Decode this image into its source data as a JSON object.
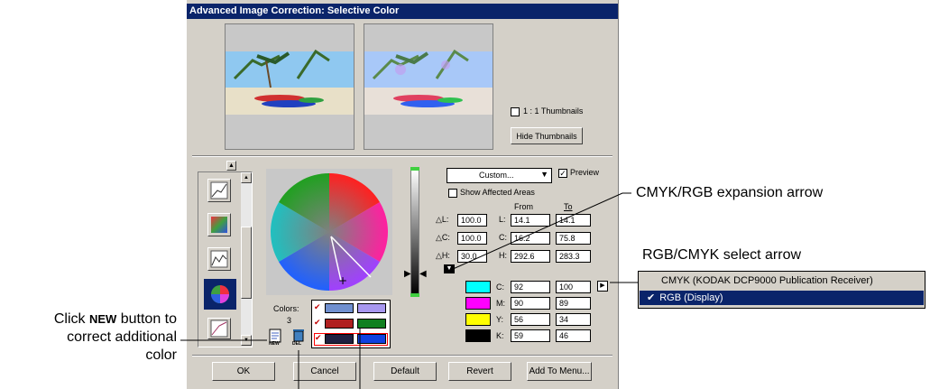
{
  "window": {
    "title": "Advanced Image Correction: Selective Color"
  },
  "thumbnails": {
    "one_to_one_label": "1 : 1 Thumbnails",
    "hide_button": "Hide Thumbnails"
  },
  "controls": {
    "preset_value": "Custom...",
    "preview_label": "Preview",
    "show_affected_label": "Show Affected Areas",
    "from_header": "From",
    "to_header": "To",
    "deltas": [
      {
        "label": "△L:",
        "value": "100.0"
      },
      {
        "label": "△C:",
        "value": "100.0"
      },
      {
        "label": "△H:",
        "value": "30.0"
      }
    ],
    "lch": [
      {
        "label": "L:",
        "from": "14.1",
        "to": "14.1"
      },
      {
        "label": "C:",
        "from": "16.2",
        "to": "75.8"
      },
      {
        "label": "H:",
        "from": "292.6",
        "to": "283.3"
      }
    ],
    "cmyk": [
      {
        "label": "C:",
        "color": "#00ffff",
        "from": "92",
        "to": "100"
      },
      {
        "label": "M:",
        "color": "#ff00ff",
        "from": "90",
        "to": "89"
      },
      {
        "label": "Y:",
        "color": "#ffff00",
        "from": "56",
        "to": "34"
      },
      {
        "label": "K:",
        "color": "#000000",
        "from": "59",
        "to": "46"
      }
    ],
    "colors_label": "Colors:",
    "colors_count": "3",
    "swatches": [
      {
        "from": "#7090d0",
        "to": "#a898f0"
      },
      {
        "from": "#b02020",
        "to": "#108020"
      },
      {
        "from": "#202040",
        "to": "#1040e0"
      }
    ],
    "new_icon_label": "NEW",
    "del_icon_label": "DEL"
  },
  "buttons": {
    "ok": "OK",
    "cancel": "Cancel",
    "default": "Default",
    "revert": "Revert",
    "add_to_menu": "Add To Menu..."
  },
  "dropdown_menu": {
    "items": [
      {
        "label": "CMYK (KODAK DCP9000 Publication Receiver)",
        "selected": false
      },
      {
        "label": "RGB (Display)",
        "selected": true,
        "check": "✔"
      }
    ]
  },
  "annotations": {
    "expansion_arrow": "CMYK/RGB expansion arrow",
    "select_arrow": "RGB/CMYK select arrow",
    "new_button_line1_a": "Click ",
    "new_button_line1_b": "NEW",
    "new_button_line1_c": " button to",
    "new_button_line2": "correct additional",
    "new_button_line3": "color"
  }
}
